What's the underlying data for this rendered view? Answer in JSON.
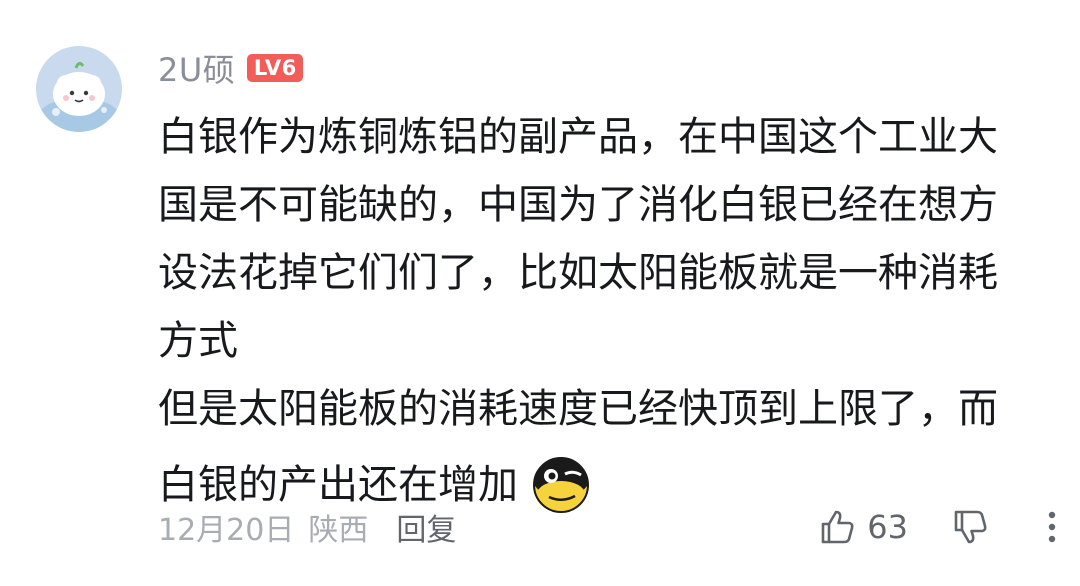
{
  "comment": {
    "username": "2U硕",
    "level_badge": "LV6",
    "content_lines": [
      "白银作为炼铜炼铝的副产品，在中国这个工业大",
      "国是不可能缺的，中国为了消化白银已经在想方",
      "设法花掉它们们了，比如太阳能板就是一种消耗",
      "方式",
      "但是太阳能板的消耗速度已经快顶到上限了，而",
      "白银的产出还在增加"
    ],
    "emoji": "doge-emoji",
    "date": "12月20日",
    "location": "陕西",
    "reply_label": "回复",
    "like_count": "63"
  },
  "colors": {
    "username": "#8a8e99",
    "badge": "#f25d59",
    "text": "#18191c",
    "meta": "#a8acb3",
    "action": "#61666d"
  },
  "icons": {
    "avatar": "cartoon-avatar",
    "like": "thumbs-up-icon",
    "dislike": "thumbs-down-icon",
    "more": "more-vertical-icon"
  }
}
